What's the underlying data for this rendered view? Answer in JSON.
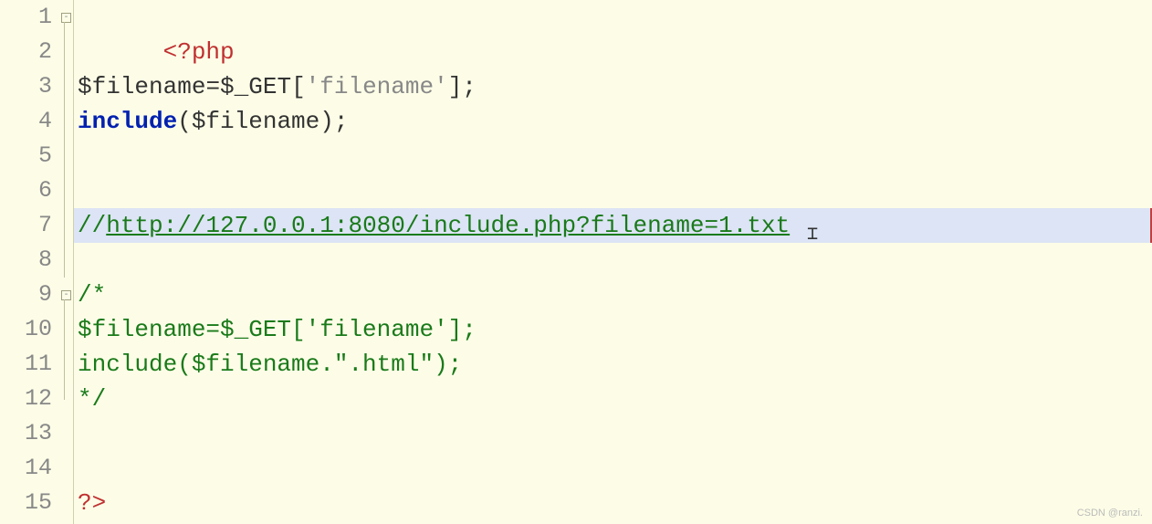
{
  "lines": {
    "1": "1",
    "2": "2",
    "3": "3",
    "4": "4",
    "5": "5",
    "6": "6",
    "7": "7",
    "8": "8",
    "9": "9",
    "10": "10",
    "11": "11",
    "12": "12",
    "13": "13",
    "14": "14",
    "15": "15"
  },
  "code": {
    "php_open": "<?php",
    "line3_var": "$filename",
    "line3_eq": "=",
    "line3_get": "$_GET",
    "line3_br1": "[",
    "line3_str": "'filename'",
    "line3_br2": "];",
    "line4_include": "include",
    "line4_p1": "(",
    "line4_var": "$filename",
    "line4_p2": ");",
    "line7_slashes": "//",
    "line7_url": "http://127.0.0.1:8080/include.php?filename=1.txt",
    "line9_open": "/*",
    "line10": "$filename=$_GET['filename'];",
    "line11": "include($filename.\".html\");",
    "line12_close": "*/",
    "php_close": "?>"
  },
  "fold": {
    "minus": "-"
  },
  "watermark": "CSDN @ranzi.",
  "cursor_glyph": "⌶"
}
